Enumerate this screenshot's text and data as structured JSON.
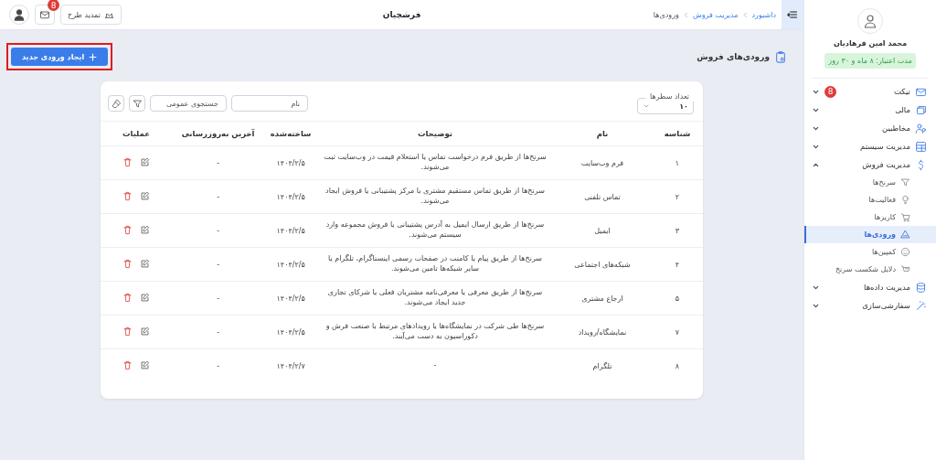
{
  "topbar": {
    "breadcrumb": [
      "داشبورد",
      "مدیریت فروش",
      "ورودی‌ها"
    ],
    "brand": "فرشچیان",
    "renew_button": "تمدید طرح",
    "mail_badge": "8"
  },
  "sidebar": {
    "user_name": "محمد امین فرهادیان",
    "validity": "مدت اعتبار: ۸ ماه و ۳۰ روز",
    "items": [
      {
        "label": "تیکت",
        "badge": "8",
        "expanded": false
      },
      {
        "label": "مالی",
        "expanded": false
      },
      {
        "label": "مخاطبین",
        "expanded": false
      },
      {
        "label": "مدیریت سیستم",
        "expanded": false
      },
      {
        "label": "مدیریت فروش",
        "expanded": true,
        "children": [
          {
            "label": "سرنخ‌ها",
            "selected": false
          },
          {
            "label": "فعالیت‌ها",
            "selected": false
          },
          {
            "label": "کاریزها",
            "selected": false
          },
          {
            "label": "ورودی‌ها",
            "selected": true
          },
          {
            "label": "کمپین‌ها",
            "selected": false
          },
          {
            "label": "دلایل شکست سرنخ",
            "selected": false
          }
        ]
      },
      {
        "label": "مدیریت داده‌ها",
        "expanded": false
      },
      {
        "label": "سفارشی‌سازی",
        "expanded": false
      }
    ]
  },
  "page": {
    "title": "ورودی‌های فروش",
    "create_button": "ایجاد ورودی جدید",
    "create_highlighted": true
  },
  "toolbar": {
    "rows_label": "تعداد سطرها",
    "rows_value": "۱۰",
    "name_placeholder": "نام",
    "search_placeholder": "جستجوی عمومی"
  },
  "table": {
    "columns": [
      "شناسه",
      "نام",
      "توضیحات",
      "ساخته‌شده",
      "آخرین به‌روزرسانی",
      "عملیات"
    ],
    "rows": [
      {
        "id": "۱",
        "name": "فرم وب‌سایت",
        "description": "سرنخ‌ها از طریق فرم درخواست تماس یا استعلام قیمت در وب‌سایت ثبت می‌شوند.",
        "created": "۱۴۰۴/۲/۵",
        "updated": "-"
      },
      {
        "id": "۲",
        "name": "تماس تلفنی",
        "description": "سرنخ‌ها از طریق تماس مستقیم مشتری با مرکز پشتیبانی یا فروش ایجاد می‌شوند.",
        "created": "۱۴۰۴/۲/۵",
        "updated": "-"
      },
      {
        "id": "۳",
        "name": "ایمیل",
        "description": "سرنخ‌ها از طریق ارسال ایمیل به آدرس پشتیبانی یا فروش مجموعه وارد سیستم می‌شوند.",
        "created": "۱۴۰۴/۲/۵",
        "updated": "-"
      },
      {
        "id": "۴",
        "name": "شبکه‌های اجتماعی",
        "description": "سرنخ‌ها از طریق پیام یا کامنت در صفحات رسمی اینستاگرام، تلگرام یا سایر شبکه‌ها تامین می‌شوند.",
        "created": "۱۴۰۴/۲/۵",
        "updated": "-"
      },
      {
        "id": "۵",
        "name": "ارجاع مشتری",
        "description": "سرنخ‌ها از طریق معرفی یا معرفی‌نامه مشتریان فعلی یا شرکای تجاری جدید ایجاد می‌شوند.",
        "created": "۱۴۰۴/۲/۵",
        "updated": "-"
      },
      {
        "id": "۷",
        "name": "نمایشگاه/رویداد",
        "description": "سرنخ‌ها طی شرکت در نمایشگاه‌ها یا رویدادهای مرتبط با صنعت فرش و دکوراسیون به دست می‌آیند.",
        "created": "۱۴۰۴/۲/۵",
        "updated": "-"
      },
      {
        "id": "۸",
        "name": "تلگرام",
        "description": "-",
        "created": "۱۴۰۴/۲/۷",
        "updated": "-"
      }
    ]
  }
}
